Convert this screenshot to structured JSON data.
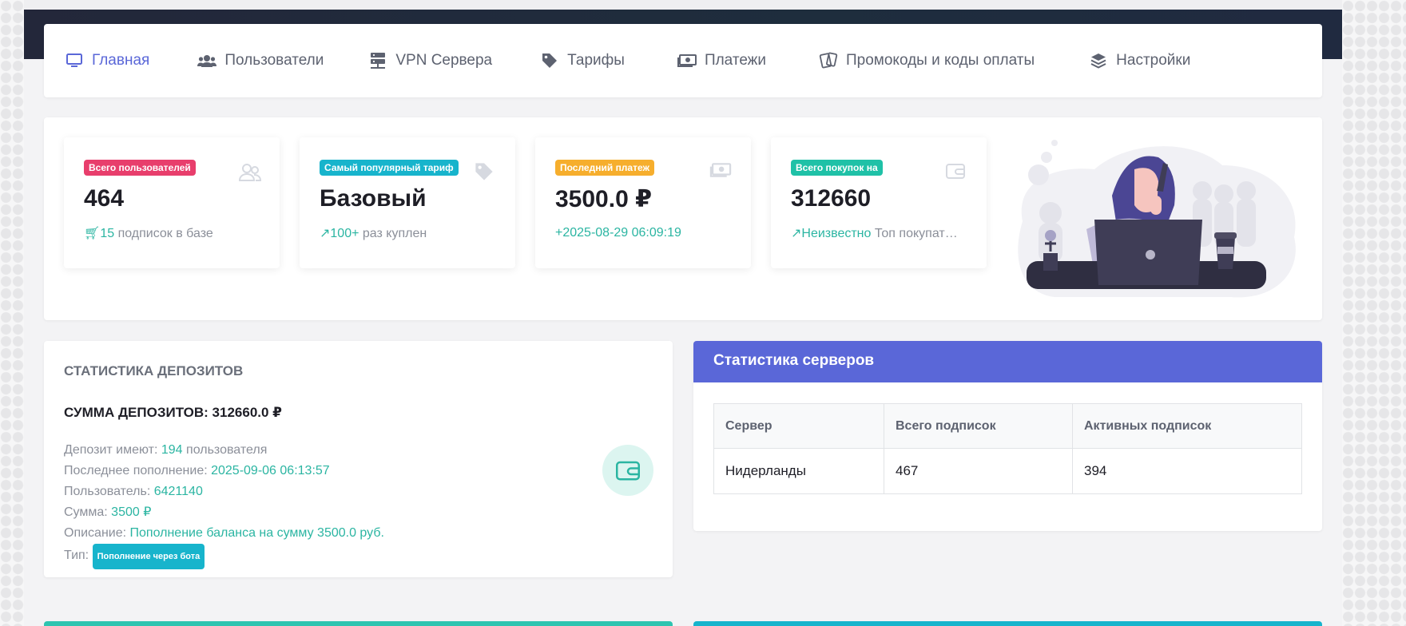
{
  "nav": {
    "items": [
      {
        "label": "Главная",
        "icon": "monitor-icon",
        "active": true
      },
      {
        "label": "Пользователи",
        "icon": "users-icon"
      },
      {
        "label": "VPN Сервера",
        "icon": "server-icon"
      },
      {
        "label": "Тарифы",
        "icon": "tag-icon"
      },
      {
        "label": "Платежи",
        "icon": "money-icon"
      },
      {
        "label": "Промокоды и коды оплаты",
        "icon": "cards-icon"
      },
      {
        "label": "Настройки",
        "icon": "layers-icon"
      }
    ]
  },
  "stats": [
    {
      "badge": "Всего пользователей",
      "value": "464",
      "sub_highlight": "15",
      "sub_text": "подписок в базе",
      "icon": "users-icon"
    },
    {
      "badge": "Самый популярный тариф",
      "value": "Базовый",
      "sub_highlight": "100+",
      "sub_text": "раз куплен",
      "icon": "tag-icon"
    },
    {
      "badge": "Последний платеж",
      "value": "3500.0 ₽",
      "sub_highlight": "2025-08-29 06:09:19",
      "sub_text": "",
      "icon": "money-icon"
    },
    {
      "badge": "Всего покупок на",
      "value": "312660",
      "sub_highlight": "Неизвестно",
      "sub_text": "Топ покупат…",
      "icon": "wallet-icon"
    }
  ],
  "deposits": {
    "title": "СТАТИСТИКА ДЕПОЗИТОВ",
    "sum": "СУММА ДЕПОЗИТОВ: 312660.0 ₽",
    "has_label": "Депозит имеют:",
    "has_count": "194",
    "has_suffix": "пользователя",
    "last_label": "Последнее пополнение:",
    "last_value": "2025-09-06 06:13:57",
    "user_label": "Пользователь:",
    "user_value": "6421140",
    "amount_label": "Сумма:",
    "amount_value": "3500 ₽",
    "desc_label": "Описание:",
    "desc_value": "Пополнение баланса на сумму 3500.0 руб.",
    "type_label": "Тип:",
    "type_badge": "Пополнение через бота"
  },
  "servers": {
    "title": "Статистика серверов",
    "columns": [
      "Сервер",
      "Всего подписок",
      "Активных подписок"
    ],
    "rows": [
      [
        "Нидерланды",
        "467",
        "394"
      ]
    ]
  },
  "colors": {
    "accent": "#5a67d8",
    "teal": "#2bb5a2",
    "pink": "#e83e6c",
    "cyan": "#17b4cc",
    "orange": "#f6ae2d"
  }
}
